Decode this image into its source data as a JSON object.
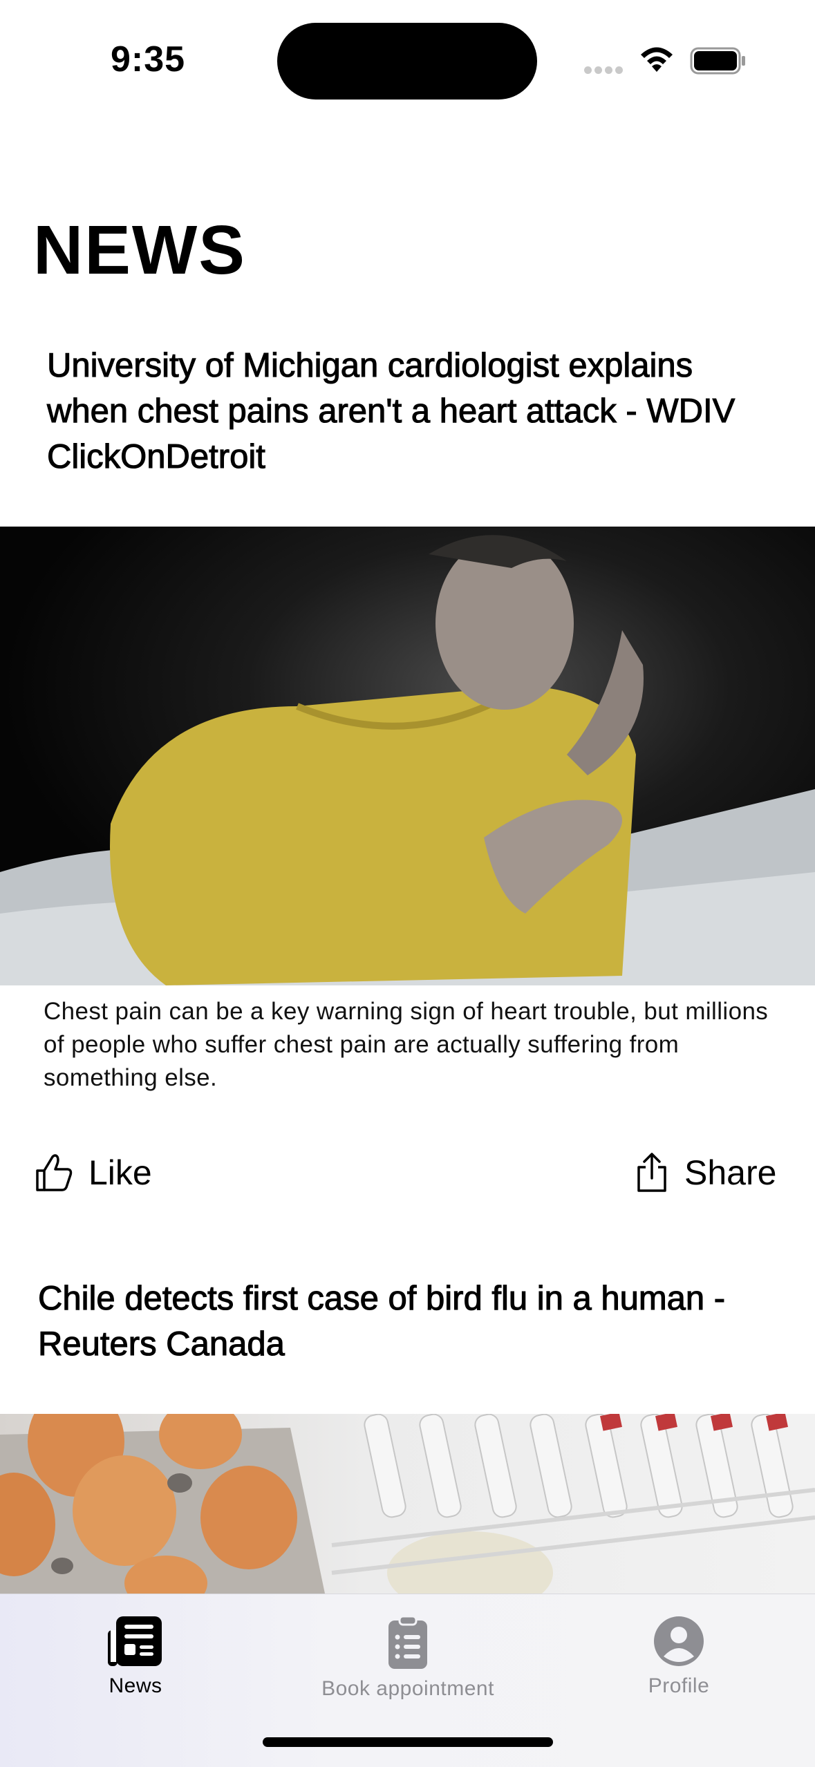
{
  "status_bar": {
    "time": "9:35"
  },
  "page": {
    "title": "NEWS"
  },
  "articles": [
    {
      "headline": "University of Michigan cardiologist explains when chest pains aren't a heart attack - WDIV ClickOnDetroit",
      "summary": "Chest pain can be a key warning sign of heart trouble, but millions of people who suffer chest pain are actually suffering from something else.",
      "like_label": "Like",
      "share_label": "Share"
    },
    {
      "headline": "Chile detects first case of bird flu in a human - Reuters Canada"
    }
  ],
  "tab_bar": {
    "items": [
      {
        "label": "News",
        "icon": "newspaper-icon",
        "selected": true
      },
      {
        "label": "Book appointment",
        "icon": "clipboard-icon",
        "selected": false
      },
      {
        "label": "Profile",
        "icon": "person-circle-icon",
        "selected": false
      }
    ]
  },
  "colors": {
    "selected_tab": "#000000",
    "unselected_tab": "#8e8e93"
  }
}
